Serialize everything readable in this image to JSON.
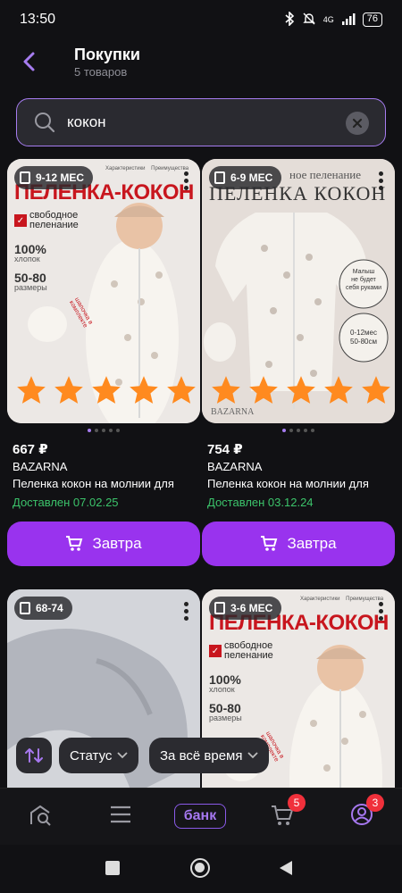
{
  "status": {
    "time": "13:50",
    "network": "4G",
    "battery": "76"
  },
  "header": {
    "title": "Покупки",
    "subtitle": "5 товаров"
  },
  "search": {
    "value": "кокон"
  },
  "products": [
    {
      "age": "9-12 МЕС",
      "price": "667 ₽",
      "brand": "BAZARNA",
      "name": "Пеленка кокон на молнии для",
      "status": "Доставлен 07.02.25",
      "button": "Завтра",
      "img_title": "ПЕЛЕНКА-КОКОН",
      "img_tag": "свободное пеленание",
      "img_lines": [
        "100%",
        "хлопок",
        "50-80",
        "размеры"
      ],
      "img_note": "шапочка в комплекте",
      "img_header": [
        "Характеристики",
        "Преимущества"
      ]
    },
    {
      "age": "6-9 МЕС",
      "price": "754 ₽",
      "brand": "BAZARNA",
      "name": "Пеленка кокон на молнии для",
      "status": "Доставлен 03.12.24",
      "button": "Завтра",
      "img_title_top": "ное пеленание",
      "img_title": "ПЕЛЕНКА КОКОН",
      "img_circle1": [
        "Малыш",
        "не будет",
        "себя руками"
      ],
      "img_circle2": [
        "0-12мес",
        "50-80см"
      ],
      "img_logo": "BAZARNA"
    },
    {
      "age": "68-74"
    },
    {
      "age": "3-6 МЕС",
      "img_title": "ПЕЛЕНКА-КОКОН",
      "img_tag": "свободное пеленание",
      "img_lines": [
        "100%",
        "хлопок",
        "50-80",
        "размеры"
      ],
      "img_note": "шапочка в комплекте",
      "img_header": [
        "Характеристики",
        "Преимущества"
      ]
    }
  ],
  "filters": {
    "status": "Статус",
    "period": "За всё время"
  },
  "nav": {
    "bank": "банк",
    "cart_count": "5",
    "profile_count": "3"
  },
  "colors": {
    "accent": "#9933ee",
    "delivered": "#3cc46b",
    "star": "#ff8a1f"
  }
}
